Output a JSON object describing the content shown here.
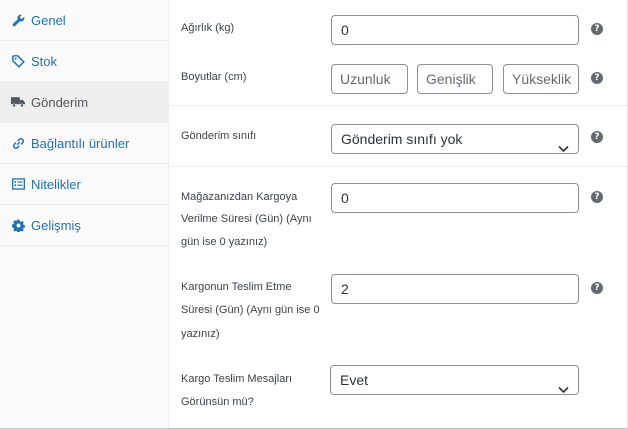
{
  "sidebar": {
    "items": [
      {
        "label": "Genel",
        "icon": "wrench-icon"
      },
      {
        "label": "Stok",
        "icon": "tag-icon"
      },
      {
        "label": "Gönderim",
        "icon": "truck-icon",
        "active": true
      },
      {
        "label": "Bağlantılı ürünler",
        "icon": "link-icon"
      },
      {
        "label": "Nitelikler",
        "icon": "list-icon"
      },
      {
        "label": "Gelişmiş",
        "icon": "gear-icon"
      }
    ]
  },
  "fields": {
    "weight": {
      "label": "Ağırlık (kg)",
      "value": "0"
    },
    "dimensions": {
      "label": "Boyutlar (cm)",
      "length_placeholder": "Uzunluk",
      "width_placeholder": "Genişlik",
      "height_placeholder": "Yükseklik"
    },
    "shipping_class": {
      "label": "Gönderim sınıfı",
      "value": "Gönderim sınıfı yok"
    },
    "handover_days": {
      "label_line1": "Mağazanızdan Kargoya",
      "label_line2": "Verilme Süresi (Gün) (Aynı",
      "label_line3": "gün ise 0 yazınız)",
      "value": "0"
    },
    "delivery_days": {
      "label_line1": "Kargonun Teslim Etme",
      "label_line2": "Süresi (Gün) (Aynı gün ise 0",
      "label_line3": "yazınız)",
      "value": "2"
    },
    "delivery_messages": {
      "label_line1": "Kargo Teslim Mesajları",
      "label_line2": "Görünsün mü?",
      "value": "Evet"
    }
  },
  "help_glyph": "?",
  "colors": {
    "link": "#2271b1",
    "active_tab_bg": "#eeeeee",
    "help_icon": "#646970"
  }
}
